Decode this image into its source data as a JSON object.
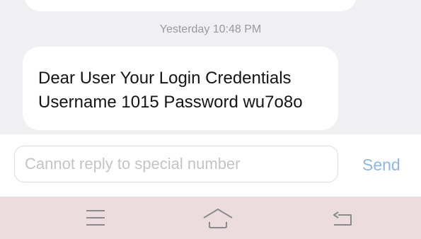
{
  "conversation": {
    "timestamp": "Yesterday 10:48 PM",
    "message": "Dear User Your Login Credentials\nUsername 1015 Password wu7o8o"
  },
  "composer": {
    "placeholder": "Cannot reply to special number",
    "send_label": "Send"
  },
  "navigation": {
    "menu_icon": "menu-icon",
    "home_icon": "home-icon",
    "back_icon": "back-icon"
  },
  "colors": {
    "chat_background": "#f0f0f2",
    "bubble": "#ffffff",
    "send_text": "#8fb6e6",
    "nav_background": "#ecdcdf"
  }
}
